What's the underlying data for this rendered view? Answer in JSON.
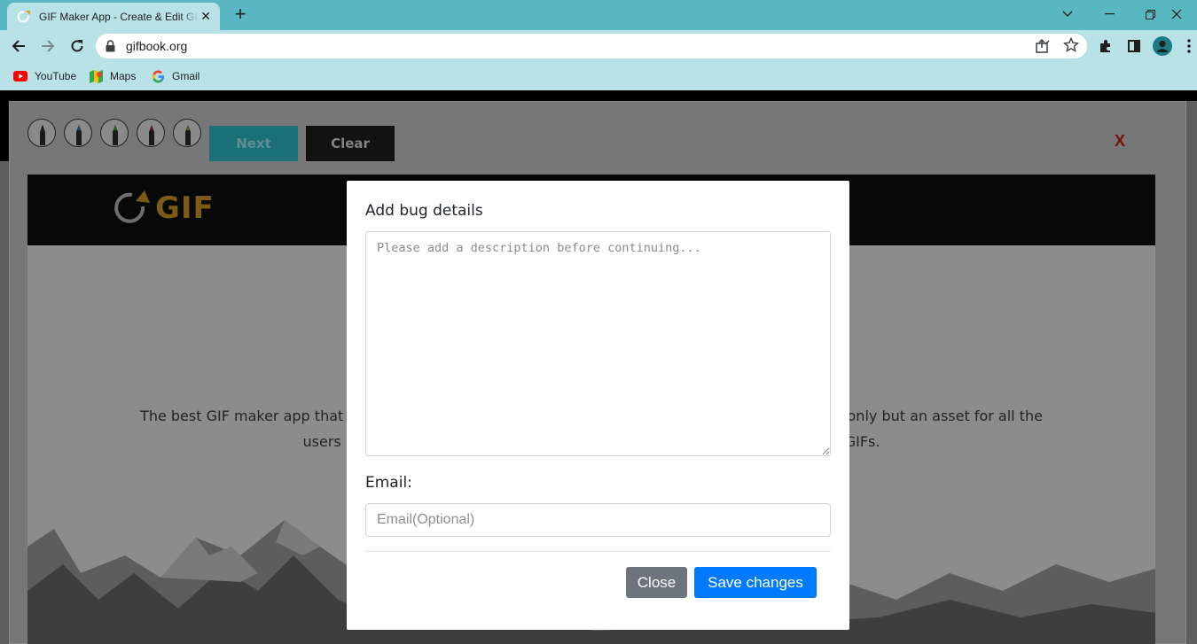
{
  "browser": {
    "tab_title": "GIF Maker App - Create & Edit GIFs",
    "url": "gifbook.org",
    "bookmarks": [
      {
        "label": "YouTube",
        "icon": "youtube-icon"
      },
      {
        "label": "Maps",
        "icon": "maps-icon"
      },
      {
        "label": "Gmail",
        "icon": "google-icon"
      }
    ]
  },
  "page": {
    "toolbar": {
      "pens": [
        "black",
        "blue",
        "green",
        "red",
        "yellow"
      ],
      "next_label": "Next",
      "clear_label": "Clear",
      "close_label": "X"
    },
    "logo_text": "GIF",
    "hero_line1_left": "The best GIF maker app that he",
    "hero_line1_right": "o-only but an asset for all the",
    "hero_line2_left": "users",
    "hero_line2_right": "GIFs."
  },
  "modal": {
    "title": "Add bug details",
    "description_placeholder": "Please add a description before continuing...",
    "email_label": "Email:",
    "email_placeholder": "Email(Optional)",
    "close_label": "Close",
    "save_label": "Save changes"
  },
  "colors": {
    "tab_strip": "#58b7c1",
    "toolbar": "#b9e2e7",
    "primary_button": "#007bff",
    "secondary_button": "#6c757d"
  }
}
